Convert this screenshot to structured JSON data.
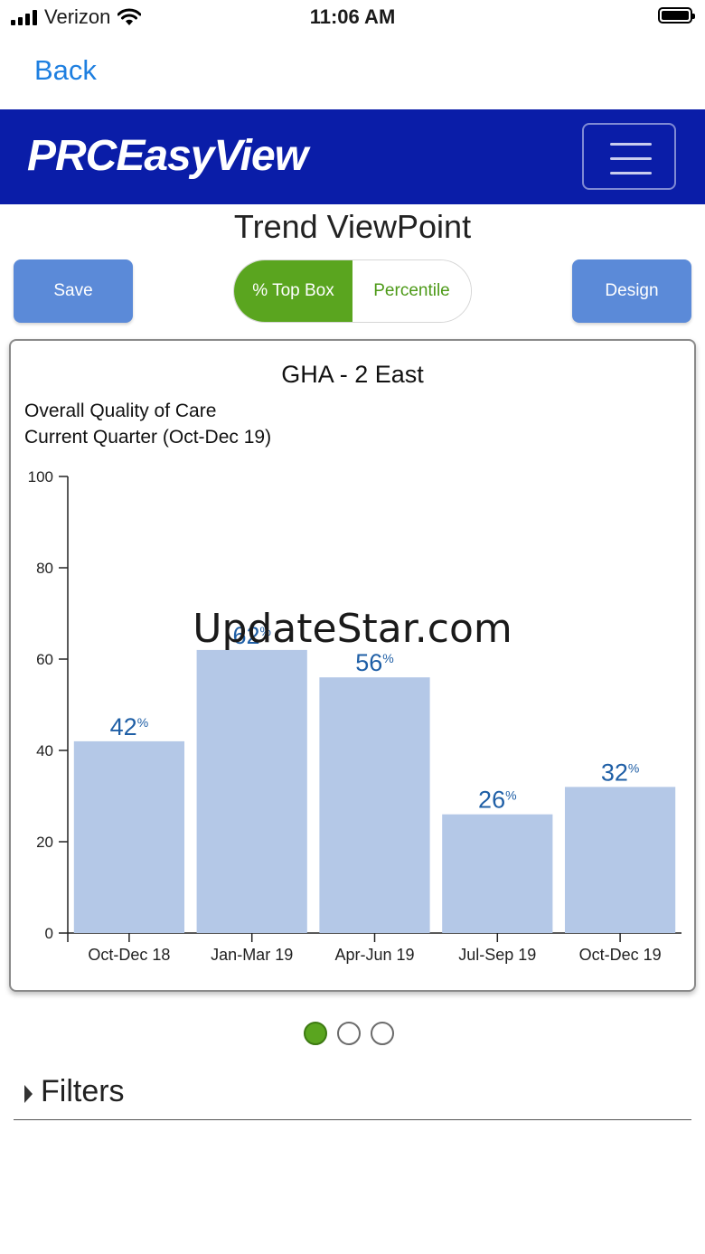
{
  "status_bar": {
    "carrier": "Verizon",
    "time": "11:06 AM"
  },
  "nav": {
    "back_label": "Back"
  },
  "brand": {
    "logo_text": "PRCEasyView",
    "color": "#0a1da8"
  },
  "page": {
    "title": "Trend ViewPoint"
  },
  "toolbar": {
    "save_label": "Save",
    "design_label": "Design",
    "segments": [
      "% Top Box",
      "Percentile"
    ],
    "active_segment": "% Top Box"
  },
  "chart_card": {
    "title": "GHA - 2 East",
    "subtitle_line1": "Overall Quality of Care",
    "subtitle_line2": "Current Quarter (Oct-Dec 19)"
  },
  "chart_data": {
    "type": "bar",
    "categories": [
      "Oct-Dec 18",
      "Jan-Mar 19",
      "Apr-Jun 19",
      "Jul-Sep 19",
      "Oct-Dec 19"
    ],
    "values": [
      42,
      62,
      56,
      26,
      32
    ],
    "value_suffix": "%",
    "ylim": [
      0,
      100
    ],
    "yticks": [
      0,
      20,
      40,
      60,
      80,
      100
    ],
    "bar_color": "#b4c8e7",
    "label_color": "#1f5fa6"
  },
  "watermark": "UpdateStar.com",
  "pager": {
    "count": 3,
    "active_index": 0
  },
  "filters": {
    "label": "Filters"
  }
}
